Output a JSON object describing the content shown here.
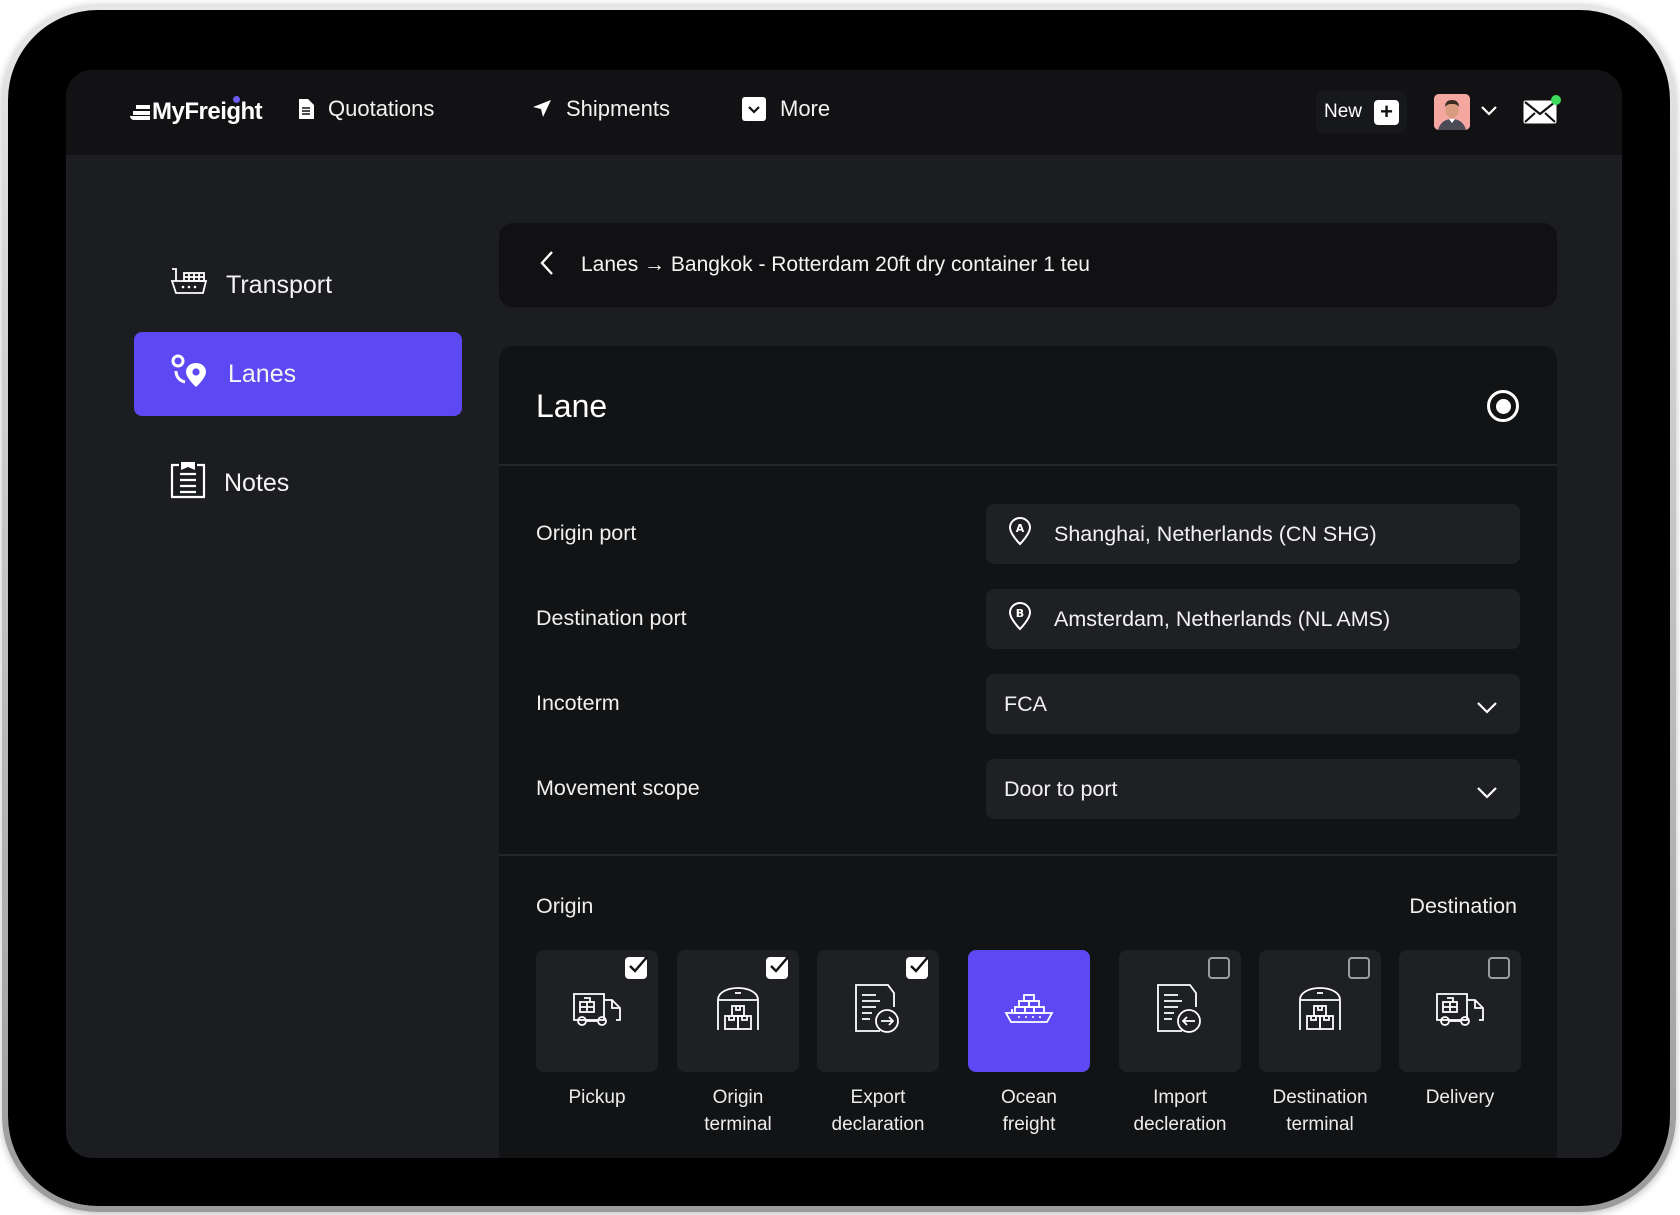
{
  "app": {
    "brand": "MyFreight",
    "accent_color": "#5d49f3"
  },
  "topnav": {
    "items": [
      {
        "label": "Quotations",
        "icon": "document-icon"
      },
      {
        "label": "Shipments",
        "icon": "paper-plane-icon"
      },
      {
        "label": "More",
        "icon": "chevron-down-box-icon"
      }
    ],
    "new_label": "New",
    "new_icon": "plus-icon",
    "avatar": "user-avatar",
    "notifications": {
      "icon": "mail-icon",
      "has_unread": true
    }
  },
  "sidebar": {
    "items": [
      {
        "label": "Transport",
        "icon": "ship-icon",
        "active": false
      },
      {
        "label": "Lanes",
        "icon": "route-pins-icon",
        "active": true
      },
      {
        "label": "Notes",
        "icon": "clipboard-icon",
        "active": false
      }
    ]
  },
  "breadcrumb": {
    "back_icon": "chevron-left-icon",
    "text": "Lanes → Bangkok - Rotterdam 20ft dry container 1 teu"
  },
  "lane": {
    "title": "Lane",
    "selected": true,
    "fields": [
      {
        "label": "Origin port",
        "value": "Shanghai, Netherlands (CN SHG)",
        "icon": "pin-a-icon"
      },
      {
        "label": "Destination port",
        "value": "Amsterdam, Netherlands (NL AMS)",
        "icon": "pin-b-icon"
      },
      {
        "label": "Incoterm",
        "value": "FCA",
        "type": "select"
      },
      {
        "label": "Movement scope",
        "value": "Door to port",
        "type": "select"
      }
    ],
    "services_origin_label": "Origin",
    "services_destination_label": "Destination",
    "services": [
      {
        "name_line1": "Pickup",
        "name_line2": "",
        "checked": true,
        "active": false,
        "icon": "truck-icon"
      },
      {
        "name_line1": "Origin",
        "name_line2": "terminal",
        "checked": true,
        "active": false,
        "icon": "warehouse-icon"
      },
      {
        "name_line1": "Export",
        "name_line2": "declaration",
        "checked": true,
        "active": false,
        "icon": "document-export-icon"
      },
      {
        "name_line1": "Ocean",
        "name_line2": "freight",
        "checked": true,
        "active": true,
        "icon": "ship-icon"
      },
      {
        "name_line1": "Import",
        "name_line2": "decleration",
        "checked": false,
        "active": false,
        "icon": "document-import-icon"
      },
      {
        "name_line1": "Destination",
        "name_line2": "terminal",
        "checked": false,
        "active": false,
        "icon": "warehouse-icon"
      },
      {
        "name_line1": "Delivery",
        "name_line2": "",
        "checked": false,
        "active": false,
        "icon": "truck-icon"
      }
    ]
  }
}
